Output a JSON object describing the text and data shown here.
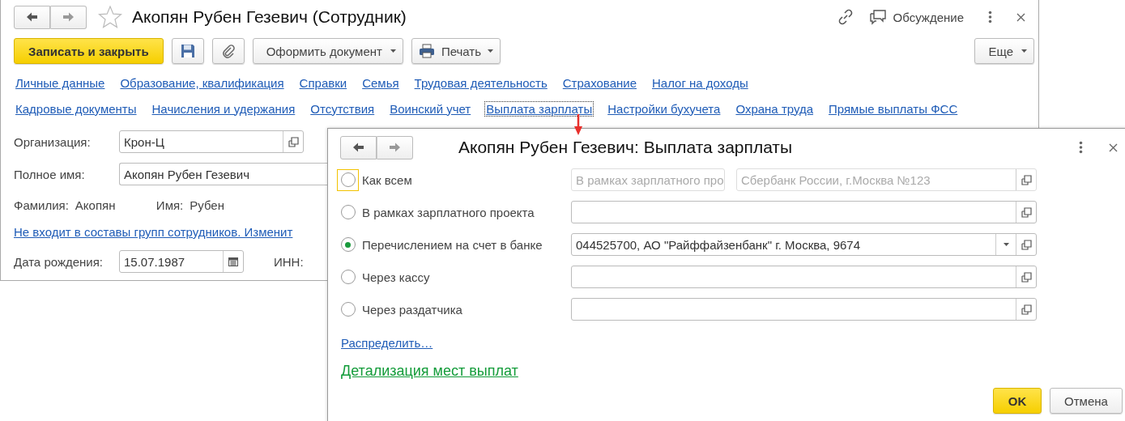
{
  "window": {
    "title": "Акопян Рубен Гезевич (Сотрудник)",
    "favorite": false,
    "discussion": "Обсуждение"
  },
  "toolbar": {
    "save_close": "Записать и закрыть",
    "create_document": "Оформить документ",
    "print": "Печать",
    "more": "Еще"
  },
  "section_rows": [
    {
      "links": [
        {
          "label": "Личные данные",
          "selected": false
        },
        {
          "label": "Образование, квалификация",
          "selected": false
        },
        {
          "label": "Справки",
          "selected": false
        },
        {
          "label": "Семья",
          "selected": false
        },
        {
          "label": "Трудовая деятельность",
          "selected": false
        },
        {
          "label": "Страхование",
          "selected": false
        },
        {
          "label": "Налог на доходы",
          "selected": false
        }
      ]
    },
    {
      "links": [
        {
          "label": "Кадровые документы",
          "selected": false
        },
        {
          "label": "Начисления и удержания",
          "selected": false
        },
        {
          "label": "Отсутствия",
          "selected": false
        },
        {
          "label": "Воинский учет",
          "selected": false
        },
        {
          "label": "Выплата зарплаты",
          "selected": true
        },
        {
          "label": "Настройки бухучета",
          "selected": false
        },
        {
          "label": "Охрана труда",
          "selected": false
        },
        {
          "label": "Прямые выплаты ФСС",
          "selected": false
        }
      ]
    }
  ],
  "form": {
    "organization": {
      "label": "Организация:",
      "value": "Крон-Ц"
    },
    "full_name": {
      "label": "Полное имя:",
      "value": "Акопян Рубен Гезевич"
    },
    "last_name": {
      "label": "Фамилия:",
      "value": "Акопян"
    },
    "first_name": {
      "label": "Имя:",
      "value": "Рубен"
    },
    "groups_link": "Не входит в составы групп сотрудников. Изменит",
    "birth_date": {
      "label": "Дата рождения:",
      "value": "15.07.1987"
    },
    "inn": {
      "label": "ИНН:"
    }
  },
  "dialog": {
    "title": "Акопян Рубен Гезевич: Выплата зарплаты",
    "options": [
      {
        "label": "Как всем",
        "selected": false,
        "focused": true,
        "fields": [
          {
            "value": "В рамках зарплатного про",
            "disabled": true,
            "dropdown": false,
            "open_button": false
          },
          {
            "value": "Сбербанк России, г.Москва №123",
            "disabled": true,
            "dropdown": false,
            "open_button": true
          }
        ]
      },
      {
        "label": "В рамках зарплатного проекта",
        "selected": false,
        "focused": false,
        "fields": [
          {
            "disabled": false,
            "dropdown": false,
            "open_button": true
          }
        ]
      },
      {
        "label": "Перечислением на счет в банке",
        "selected": true,
        "focused": false,
        "fields": [
          {
            "value": "044525700, АО \"Райффайзенбанк\" г. Москва, 9674",
            "disabled": false,
            "dropdown": true,
            "open_button": true
          }
        ]
      },
      {
        "label": "Через кассу",
        "selected": false,
        "focused": false,
        "fields": [
          {
            "disabled": false,
            "dropdown": false,
            "open_button": true
          }
        ]
      },
      {
        "label": "Через раздатчика",
        "selected": false,
        "focused": false,
        "fields": [
          {
            "disabled": false,
            "dropdown": false,
            "open_button": true
          }
        ]
      }
    ],
    "distribute_link": "Распределить…",
    "details_link": "Детализация мест выплат",
    "buttons": {
      "ok": "OK",
      "cancel": "Отмена"
    }
  }
}
